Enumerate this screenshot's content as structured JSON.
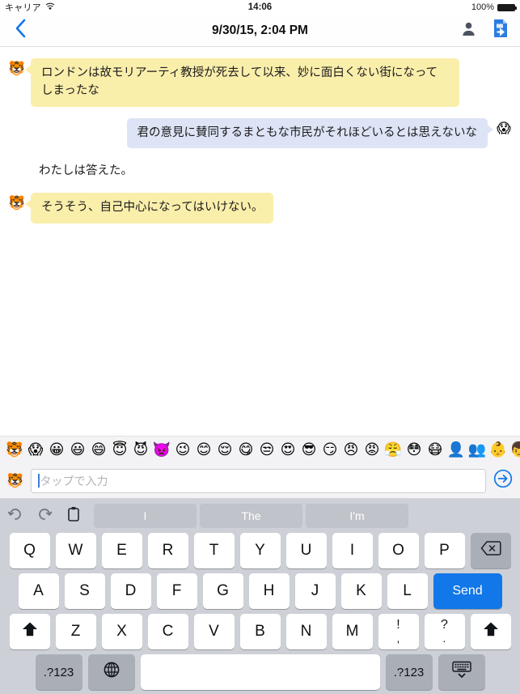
{
  "statusbar": {
    "carrier": "キャリア",
    "wifi_icon": "wifi-icon",
    "time": "14:06",
    "battery_percent": "100%"
  },
  "navbar": {
    "back_icon": "chevron-left-icon",
    "title": "9/30/15, 2:04 PM",
    "contact_icon": "person-icon",
    "export_icon": "document-export-icon"
  },
  "conversation": {
    "messages": [
      {
        "side": "left",
        "avatar": "🐯",
        "avatar_name": "tiger-face-emoji",
        "text": "ロンドンは故モリアーティ教授が死去して以来、妙に面白くない街になってしまったな"
      },
      {
        "side": "right",
        "avatar": "😱",
        "avatar_name": "screaming-face-emoji",
        "text": "君の意見に賛同するまともな市民がそれほどいるとは思えないな"
      },
      {
        "side": "narration",
        "text": "わたしは答えた。"
      },
      {
        "side": "left",
        "avatar": "🐯",
        "avatar_name": "tiger-face-emoji",
        "text": "そうそう、自己中心になってはいけない。"
      }
    ]
  },
  "emoji_strip": [
    "🐯",
    "😱",
    "😀",
    "😃",
    "😄",
    "😇",
    "😈",
    "👿",
    "😉",
    "😊",
    "😌",
    "😋",
    "😒",
    "😍",
    "😎",
    "😏",
    "😠",
    "😡",
    "😤",
    "😳",
    "😷",
    "👤",
    "👥",
    "👶",
    "👦"
  ],
  "input": {
    "avatar": "🐯",
    "placeholder": "タップで入力",
    "value": "",
    "send_icon": "send-arrow-icon"
  },
  "keyboard": {
    "predictions": [
      "I",
      "The",
      "I'm"
    ],
    "undo_icon": "undo-icon",
    "redo_icon": "redo-icon",
    "paste_icon": "paste-icon",
    "row1": [
      "Q",
      "W",
      "E",
      "R",
      "T",
      "Y",
      "U",
      "I",
      "O",
      "P"
    ],
    "backspace_icon": "backspace-icon",
    "row2": [
      "A",
      "S",
      "D",
      "F",
      "G",
      "H",
      "J",
      "K",
      "L"
    ],
    "send_label": "Send",
    "row3": [
      "Z",
      "X",
      "C",
      "V",
      "B",
      "N",
      "M"
    ],
    "shift_icon": "shift-icon",
    "punct_excl": "!",
    "punct_comma": ",",
    "punct_quest": "?",
    "punct_period": ".",
    "numeric_label": ".?123",
    "globe_icon": "globe-icon",
    "space_label": "",
    "numeric_label_right": ".?123",
    "dismiss_icon": "hide-keyboard-icon"
  },
  "colors": {
    "accent_blue": "#1277e8",
    "bubble_yellow": "#faeeab",
    "bubble_blue": "#dce4f5",
    "keyboard_bg": "#cdd0d6"
  }
}
